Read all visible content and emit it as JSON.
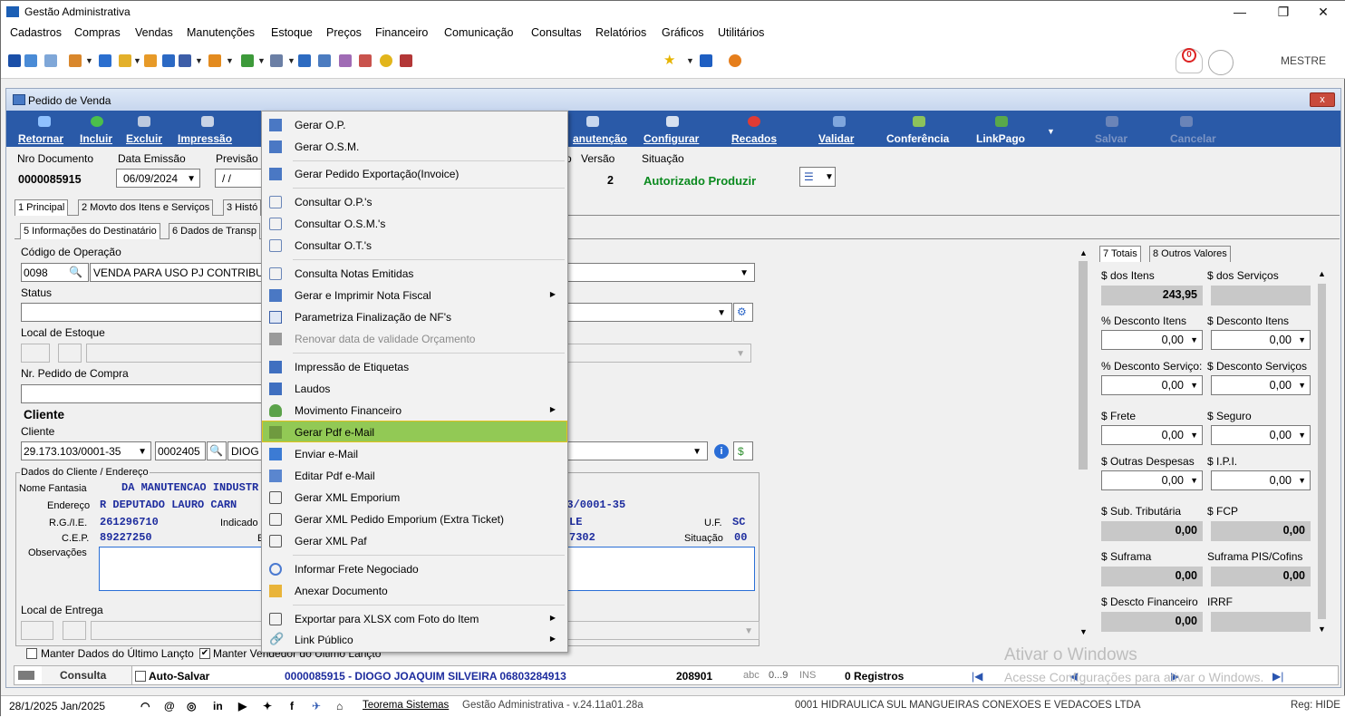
{
  "app": {
    "title": "Gestão Administrativa",
    "user": "MESTRE",
    "notif_count": "0"
  },
  "menu": [
    "Cadastros",
    "Compras",
    "Vendas",
    "Manutenções",
    "Estoque",
    "Preços",
    "Financeiro",
    "Comunicação",
    "Consultas",
    "Relatórios",
    "Gráficos",
    "Utilitários"
  ],
  "window": {
    "title": "Pedido de Venda",
    "close": "x"
  },
  "actions": {
    "retornar": "Retornar",
    "incluir": "Incluir",
    "excluir": "Excluir",
    "impressao": "Impressão",
    "manutencao": "anutenção",
    "configurar": "Configurar",
    "recados": "Recados",
    "validar": "Validar",
    "conferencia": "Conferência",
    "linkpago": "LinkPago",
    "salvar": "Salvar",
    "cancelar": "Cancelar"
  },
  "header": {
    "nro_label": "Nro Documento",
    "nro": "0000085915",
    "emissao_label": "Data Emissão",
    "emissao": "06/09/2024",
    "previsao_label": "Previsão",
    "previsao": "/ /",
    "o_label": "o",
    "versao_label": "Versão",
    "versao": "2",
    "situacao_label": "Situação",
    "situacao": "Autorizado Produzir"
  },
  "tabs1": [
    "1 Principal",
    "2 Movto dos Itens e Serviços",
    "3 Histó"
  ],
  "tabs2": [
    "5 Informações do Destinatário",
    "6 Dados de Transp"
  ],
  "form": {
    "cod_op_label": "Código de Operação",
    "cod_op": "0098",
    "op_desc": "VENDA PARA USO PJ CONTRIBU",
    "status_label": "Status",
    "local_estoque_label": "Local de Estoque",
    "nr_pedido_label": "Nr. Pedido de Compra",
    "cliente_title": "Cliente",
    "cliente_label": "Cliente",
    "cnpj": "29.173.103/0001-35",
    "cli_code": "0002405",
    "cli_name": "DIOG",
    "group_title": "Dados do Cliente / Endereço",
    "nome_fantasia_label": "Nome Fantasia",
    "nome_fantasia": "DA MANUTENCAO INDUSTR",
    "endereco_label": "Endereço",
    "endereco": "R DEPUTADO LAURO CARN",
    "cnpj2": "103/0001-35",
    "rgie_label": "R.G./I.E.",
    "rgie": "261296710",
    "indicado_label": "Indicado",
    "cidade": "LE",
    "uf_label": "U.F.",
    "uf": "SC",
    "cep_label": "C.E.P.",
    "cep": "89227250",
    "e_label": "E",
    "fone": "7302",
    "situacao2_label": "Situação",
    "situacao2": "00",
    "obs_label": "Observações",
    "local_entrega_label": "Local de Entrega",
    "manter1": "Manter Dados do Último Lançto",
    "manter2": "Manter Vendedor do Último Lançto"
  },
  "ctx": [
    {
      "t": "Gerar O.P."
    },
    {
      "t": "Gerar O.S.M."
    },
    {
      "t": "Gerar Pedido Exportação(Invoice)"
    },
    {
      "t": "Consultar O.P.'s"
    },
    {
      "t": "Consultar O.S.M.'s"
    },
    {
      "t": "Consultar O.T.'s"
    },
    {
      "t": "Consulta Notas Emitidas"
    },
    {
      "t": "Gerar e Imprimir Nota Fiscal"
    },
    {
      "t": "Parametriza Finalização de NF's"
    },
    {
      "t": "Renovar data de validade Orçamento"
    },
    {
      "t": "Impressão de Etiquetas"
    },
    {
      "t": "Laudos"
    },
    {
      "t": "Movimento Financeiro"
    },
    {
      "t": "Gerar Pdf e-Mail"
    },
    {
      "t": "Enviar e-Mail"
    },
    {
      "t": "Editar Pdf e-Mail"
    },
    {
      "t": "Gerar XML Emporium"
    },
    {
      "t": "Gerar XML Pedido Emporium (Extra Ticket)"
    },
    {
      "t": "Gerar XML Paf"
    },
    {
      "t": "Informar Frete Negociado"
    },
    {
      "t": "Anexar Documento"
    },
    {
      "t": "Exportar para XLSX com Foto do Item"
    },
    {
      "t": "Link Público"
    }
  ],
  "totals": {
    "tab1": "7 Totais",
    "tab2": "8 Outros Valores",
    "itens_label": "$ dos Itens",
    "servicos_label": "$ dos Serviços",
    "itens": "243,95",
    "desc_itens_pct_label": "% Desconto Itens",
    "desc_itens_label": "$ Desconto Itens",
    "v1": "0,00",
    "v2": "0,00",
    "desc_serv_pct_label": "% Desconto Serviço:",
    "desc_serv_label": "$ Desconto Serviços",
    "v3": "0,00",
    "v4": "0,00",
    "frete_label": "$ Frete",
    "seguro_label": "$ Seguro",
    "v5": "0,00",
    "v6": "0,00",
    "outras_label": "$ Outras Despesas",
    "ipi_label": "$ I.P.I.",
    "v7": "0,00",
    "v8": "0,00",
    "sub_label": "$ Sub. Tributária",
    "fcp_label": "$ FCP",
    "v9": "0,00",
    "v10": "0,00",
    "suframa_label": "$ Suframa",
    "suframa_pis_label": "Suframa PIS/Cofins",
    "v11": "0,00",
    "v12": "0,00",
    "descto_fin_label": "$ Descto Financeiro",
    "irrf_label": "IRRF",
    "v13": "0,00"
  },
  "status1": {
    "consulta": "Consulta",
    "auto": "Auto-Salvar",
    "doc": "0000085915 - DIOGO JOAQUIM SILVEIRA 06803284913",
    "num": "208901",
    "abc": "abc",
    "range": "0...9",
    "ins": "INS",
    "reg": "0 Registros"
  },
  "watermark": {
    "l1": "Ativar o Windows",
    "l2": "Acesse Configurações para ativar o Windows."
  },
  "status2": {
    "date": "28/1/2025 Jan/2025",
    "company_link": "Teorema Sistemas",
    "version": "Gestão Administrativa - v.24.11a01.28a",
    "firm": "0001 HIDRAULICA SUL MANGUEIRAS CONEXOES E VEDACOES LTDA",
    "reg": "Reg: HIDE"
  }
}
